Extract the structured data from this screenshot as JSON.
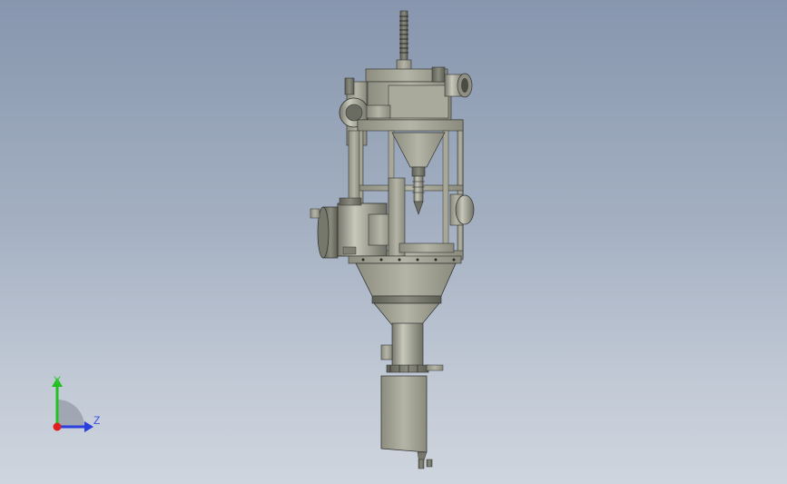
{
  "view": {
    "background_top": "#8796ae",
    "background_bottom": "#cfd5de"
  },
  "model": {
    "name": "",
    "body_color": "#9c9d8e",
    "shadow_color": "#5b5c52",
    "highlight_color": "#c9cabd"
  },
  "triad": {
    "y_label": "Y",
    "z_label": "Z",
    "x_color": "#e02020",
    "y_color": "#22c022",
    "z_color": "#2a3fe0"
  }
}
